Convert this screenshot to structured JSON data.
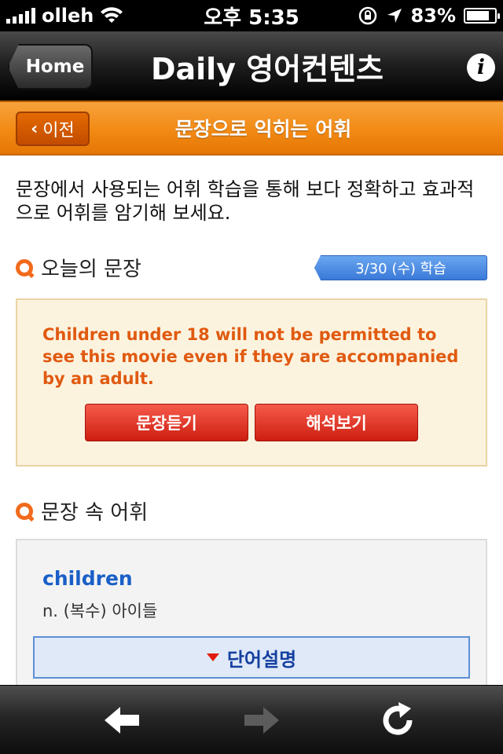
{
  "status_bar": {
    "carrier": "olleh",
    "time": "오후 5:35",
    "battery_percent": "83%",
    "battery_level": 0.83
  },
  "nav": {
    "back_label": "Home",
    "title": "Daily 영어컨텐츠",
    "info_icon": "info-icon"
  },
  "subheader": {
    "prev_label": "이전",
    "title": "문장으로 익히는 어휘"
  },
  "intro_text": "문장에서 사용되는 어휘 학습을 통해 보다 정확하고 효과적으로 어휘를 암기해 보세요.",
  "today_section": {
    "heading": "오늘의 문장",
    "date_badge": "3/30 (수) 학습",
    "sentence": "Children under 18 will not be permitted to see this movie even if they are accompanied by an adult.",
    "listen_button": "문장듣기",
    "translate_button": "해석보기"
  },
  "vocab_section": {
    "heading": "문장 속 어휘",
    "word": "children",
    "definition": "n. (복수) 아이들",
    "explain_button": "단어설명"
  },
  "toolbar": {
    "icons": [
      "back-arrow-icon",
      "forward-arrow-icon",
      "reload-icon"
    ]
  },
  "colors": {
    "orange_header": "#f28a14",
    "sentence_text": "#e05a10",
    "word_blue": "#1a5fc7",
    "badge_blue": "#3a79d8"
  }
}
